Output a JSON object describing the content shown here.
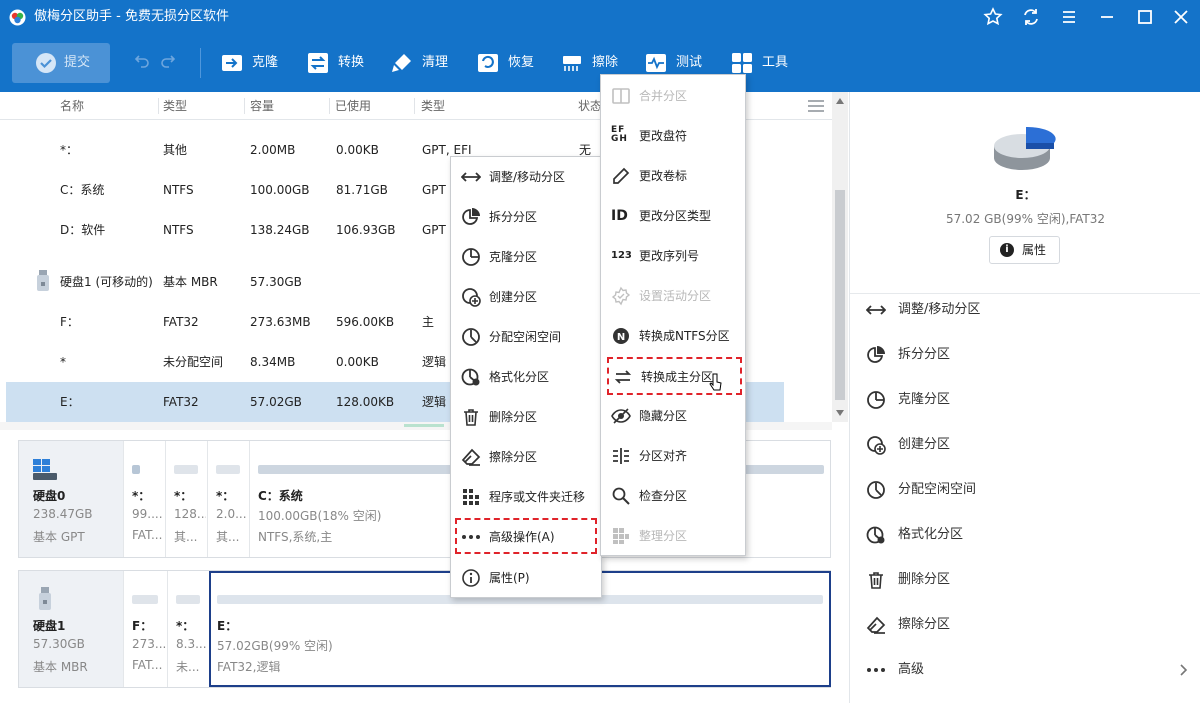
{
  "app": {
    "title": "傲梅分区助手 - 免费无损分区软件"
  },
  "toolbar": {
    "commit": "提交",
    "clone": "克隆",
    "convert": "转换",
    "clean": "清理",
    "recover": "恢复",
    "wipe": "擦除",
    "test": "测试",
    "tools": "工具"
  },
  "table": {
    "headers": [
      "名称",
      "类型",
      "容量",
      "已使用",
      "类型",
      "状态"
    ],
    "rows": [
      {
        "name": "*：",
        "type": "其他",
        "capacity": "2.00MB",
        "used": "0.00KB",
        "type2": "GPT, EFI",
        "status": "无"
      },
      {
        "name": "C：系统",
        "type": "NTFS",
        "capacity": "100.00GB",
        "used": "81.71GB",
        "type2": "GPT",
        "status": ""
      },
      {
        "name": "D：软件",
        "type": "NTFS",
        "capacity": "138.24GB",
        "used": "106.93GB",
        "type2": "GPT",
        "status": ""
      },
      {
        "name": "硬盘1 (可移动的)",
        "type": "基本 MBR",
        "capacity": "57.30GB",
        "used": "",
        "type2": "",
        "status": ""
      },
      {
        "name": "F：",
        "type": "FAT32",
        "capacity": "273.63MB",
        "used": "596.00KB",
        "type2": "主",
        "status": ""
      },
      {
        "name": "*",
        "type": "未分配空间",
        "capacity": "8.34MB",
        "used": "0.00KB",
        "type2": "逻辑",
        "status": ""
      },
      {
        "name": "E：",
        "type": "FAT32",
        "capacity": "57.02GB",
        "used": "128.00KB",
        "type2": "逻辑",
        "status": ""
      }
    ]
  },
  "disk0": {
    "name": "硬盘0",
    "size": "238.47GB",
    "style": "基本 GPT",
    "parts": [
      {
        "name": "*：",
        "size": "99....",
        "fs": "FAT..."
      },
      {
        "name": "*：",
        "size": "128...",
        "fs": "其..."
      },
      {
        "name": "*：",
        "size": "2.0...",
        "fs": "其..."
      },
      {
        "name": "C：系统",
        "size": "100.00GB(18% 空闲)",
        "fs": "NTFS,系统,主"
      }
    ]
  },
  "disk1": {
    "name": "硬盘1",
    "size": "57.30GB",
    "style": "基本 MBR",
    "parts": [
      {
        "name": "F：",
        "size": "273....",
        "fs": "FAT..."
      },
      {
        "name": "*：",
        "size": "8.3...",
        "fs": "未..."
      },
      {
        "name": "E：",
        "size": "57.02GB(99% 空闲)",
        "fs": "FAT32,逻辑"
      }
    ]
  },
  "right": {
    "drive": "E：",
    "info": "57.02 GB(99% 空闲),FAT32",
    "prop": "属性",
    "items": [
      "调整/移动分区",
      "拆分分区",
      "克隆分区",
      "创建分区",
      "分配空闲空间",
      "格式化分区",
      "删除分区",
      "擦除分区",
      "高级"
    ]
  },
  "ctx1": {
    "items": [
      "调整/移动分区",
      "拆分分区",
      "克隆分区",
      "创建分区",
      "分配空闲空间",
      "格式化分区",
      "删除分区",
      "擦除分区",
      "程序或文件夹迁移",
      "高级操作(A)",
      "属性(P)"
    ]
  },
  "ctx2": {
    "items": [
      "合并分区",
      "更改盘符",
      "更改卷标",
      "更改分区类型",
      "更改序列号",
      "设置活动分区",
      "转换成NTFS分区",
      "转换成主分区",
      "隐藏分区",
      "分区对齐",
      "检查分区",
      "整理分区"
    ]
  },
  "colors": {
    "brand": "#1473c9",
    "selection": "#cde0f1",
    "highlight": "#e0232a",
    "accent": "#2c6fd6"
  }
}
